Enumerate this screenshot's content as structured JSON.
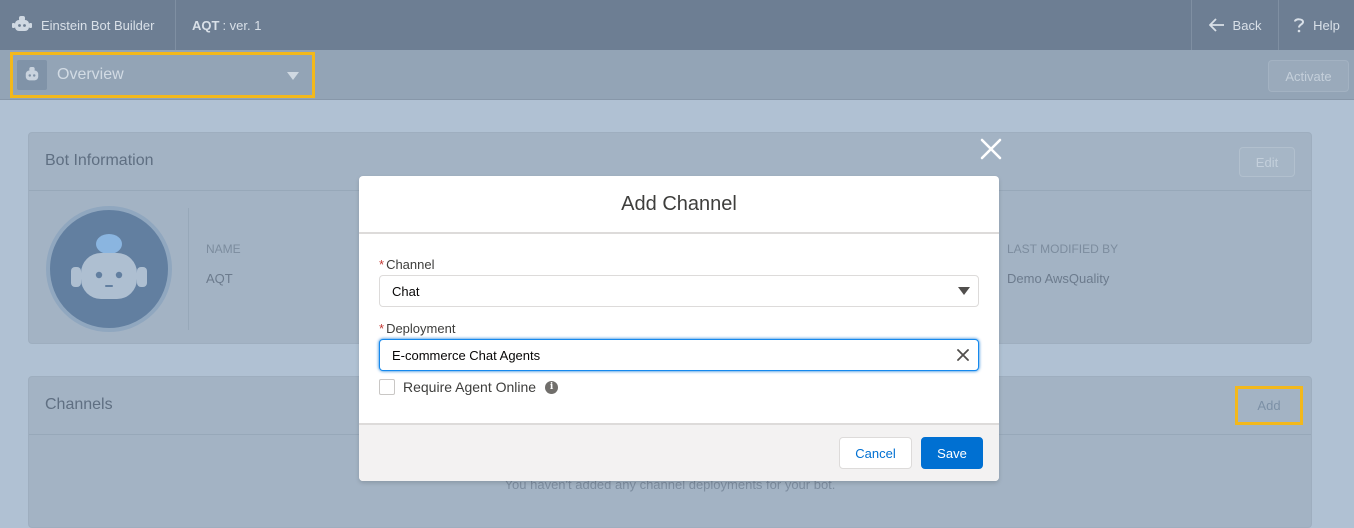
{
  "header": {
    "app_title": "Einstein Bot Builder",
    "bot_name": "AQT",
    "version_text": ": ver. 1",
    "back_label": "Back",
    "help_label": "Help",
    "icons": [
      "bot-icon",
      "arrow-left-icon",
      "question-icon"
    ]
  },
  "subheader": {
    "page_select_value": "Overview",
    "activate_label": "Activate"
  },
  "bot_information": {
    "title": "Bot Information",
    "edit_label": "Edit",
    "name_label": "NAME",
    "name_value": "AQT",
    "last_modified_label": "LAST MODIFIED BY",
    "last_modified_value": "Demo AwsQuality"
  },
  "channels": {
    "title": "Channels",
    "add_label": "Add",
    "empty_message": "You haven't added any channel deployments for your bot."
  },
  "modal": {
    "title": "Add Channel",
    "channel_label": "Channel",
    "channel_value": "Chat",
    "deployment_label": "Deployment",
    "deployment_value": "E-commerce Chat Agents",
    "require_agent_label": "Require Agent Online",
    "require_agent_checked": false,
    "cancel_label": "Cancel",
    "save_label": "Save",
    "required_marker": "*"
  },
  "colors": {
    "brand_blue": "#0070d2",
    "highlight_yellow": "#f3b81b",
    "required_red": "#c23934"
  }
}
